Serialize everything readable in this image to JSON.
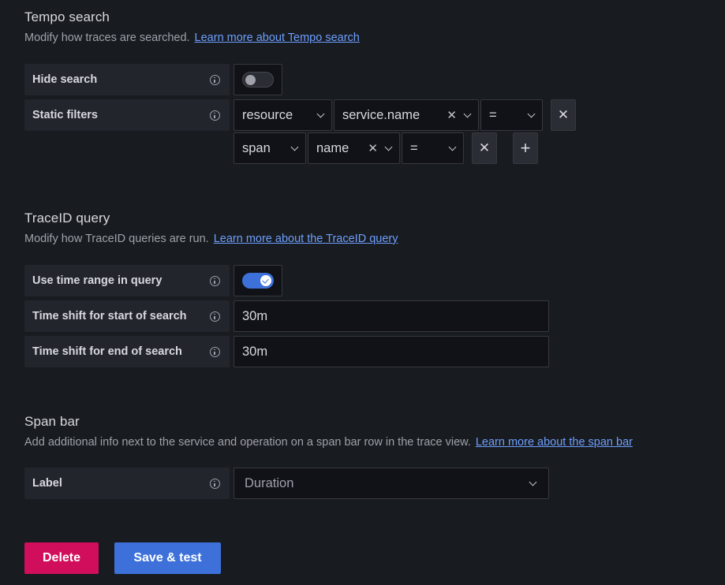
{
  "tempo_search": {
    "title": "Tempo search",
    "description": "Modify how traces are searched.",
    "link": "Learn more about Tempo search",
    "hide_search": {
      "label": "Hide search",
      "enabled": false
    },
    "static_filters": {
      "label": "Static filters",
      "rows": [
        {
          "scope": "resource",
          "tag": "service.name",
          "operator": "="
        },
        {
          "scope": "span",
          "tag": "name",
          "operator": "="
        }
      ]
    }
  },
  "traceid_query": {
    "title": "TraceID query",
    "description": "Modify how TraceID queries are run.",
    "link": "Learn more about the TraceID query",
    "use_time_range": {
      "label": "Use time range in query",
      "enabled": true
    },
    "time_shift_start": {
      "label": "Time shift for start of search",
      "value": "30m"
    },
    "time_shift_end": {
      "label": "Time shift for end of search",
      "value": "30m"
    }
  },
  "span_bar": {
    "title": "Span bar",
    "description": "Add additional info next to the service and operation on a span bar row in the trace view.",
    "link": "Learn more about the span bar",
    "label_field": {
      "label": "Label",
      "value": "Duration"
    }
  },
  "actions": {
    "delete": "Delete",
    "save_test": "Save & test"
  },
  "icons": {
    "info": "info-circle-icon",
    "remove": "close-icon",
    "add": "plus-icon",
    "dropdown": "chevron-down-icon"
  },
  "colors": {
    "background": "#181b1f",
    "link": "#6e9fff",
    "delete": "#d10e5c",
    "primary": "#3d71d9"
  }
}
